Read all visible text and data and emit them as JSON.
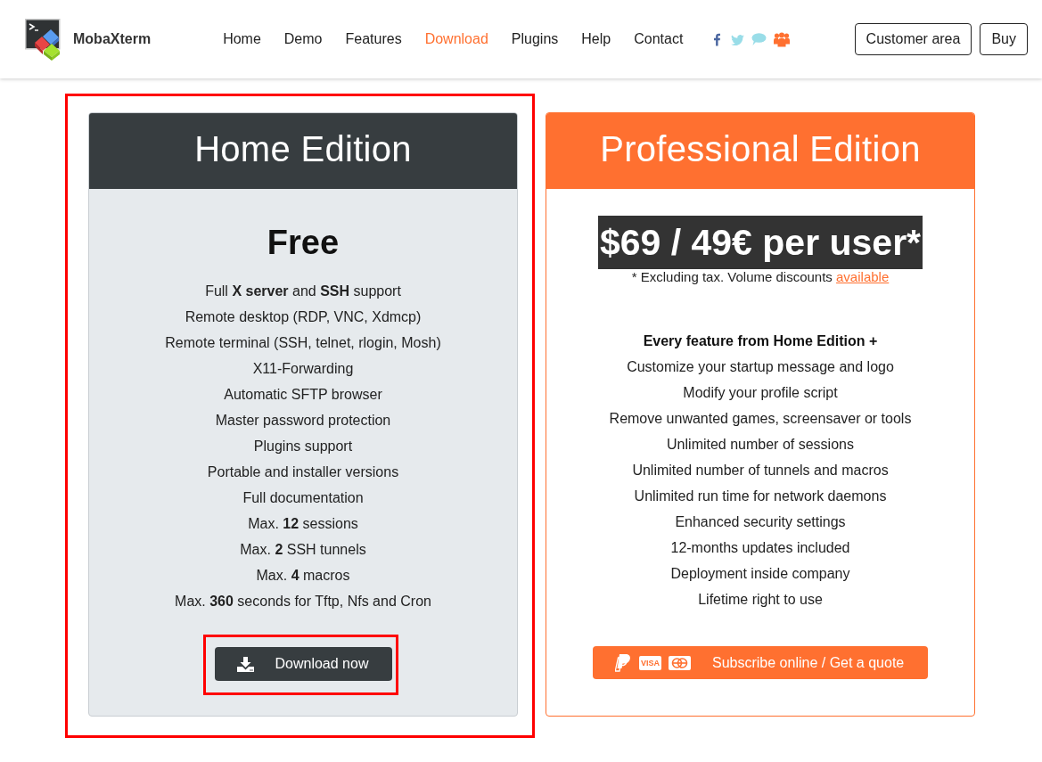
{
  "site_header": {
    "brand": "MobaXterm",
    "nav": [
      {
        "label": "Home",
        "selected": false
      },
      {
        "label": "Demo",
        "selected": false
      },
      {
        "label": "Features",
        "selected": false
      },
      {
        "label": "Download",
        "selected": true
      },
      {
        "label": "Plugins",
        "selected": false
      },
      {
        "label": "Help",
        "selected": false
      },
      {
        "label": "Contact",
        "selected": false
      }
    ],
    "buttons": [
      "Customer area",
      "Buy"
    ]
  },
  "editions": [
    {
      "kind": "home",
      "title": "Home Edition",
      "highlighted": true,
      "price": "Free",
      "features": [
        "Full **X server** and **SSH** support",
        "Remote desktop (RDP, VNC, Xdmcp)",
        "Remote terminal (SSH, telnet, rlogin, Mosh)",
        "X11-Forwarding",
        "Automatic SFTP browser",
        "Master password protection",
        "Plugins support",
        "Portable and installer versions",
        "Full documentation",
        "Max. **12** sessions",
        "Max. **2** SSH tunnels",
        "Max. **4** macros",
        "Max. **360** seconds for Tftp, Nfs and Cron"
      ],
      "button": {
        "label": "Download now",
        "highlighted": true
      }
    },
    {
      "kind": "pro",
      "title": "Professional Edition",
      "highlighted": false,
      "price": "$69 / 49€ per user*",
      "note": "* Excluding tax. Volume discounts",
      "note_link": "available",
      "features_heading": "Every feature from Home Edition +",
      "features": [
        "Customize your startup message and logo",
        "Modify your profile script",
        "Remove unwanted games, screensaver or tools",
        "Unlimited number of sessions",
        "Unlimited number of tunnels and macros",
        "Unlimited run time for network daemons",
        "Enhanced security settings",
        "12-months updates included",
        "Deployment inside company",
        "Lifetime right to use"
      ],
      "button": {
        "label": "Subscribe online / Get a quote",
        "card_label": "VISA",
        "highlighted": false
      }
    }
  ]
}
